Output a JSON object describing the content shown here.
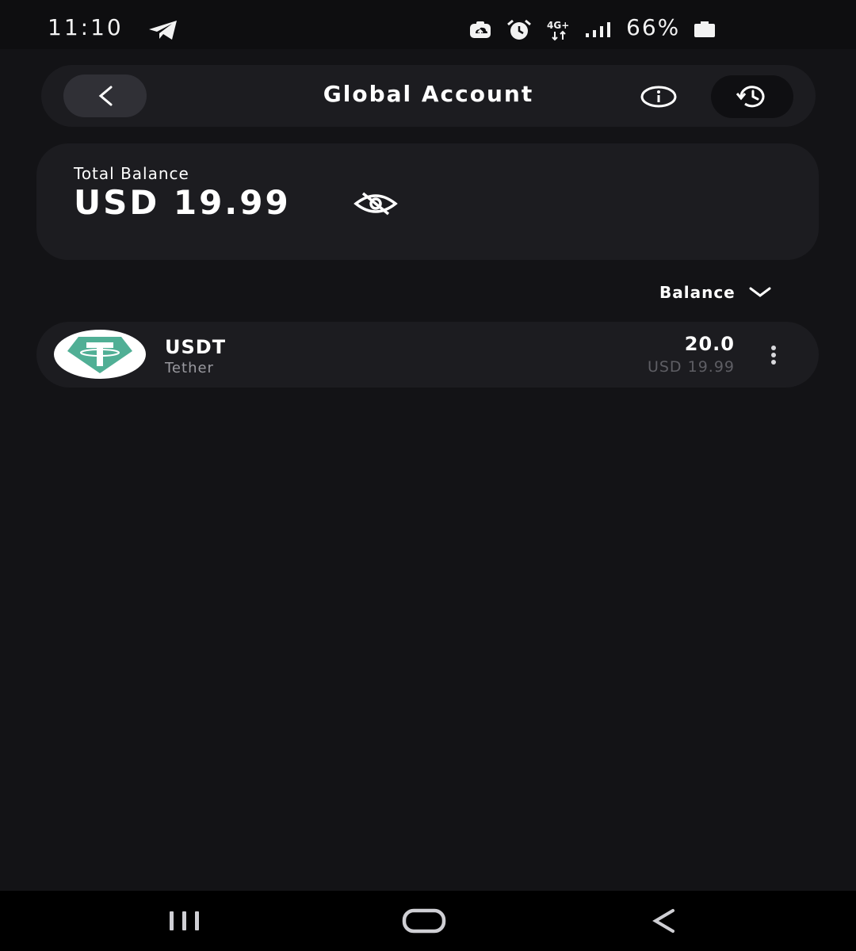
{
  "status_bar": {
    "time": "11:10",
    "network": "4G+",
    "battery_percent": "66%",
    "icons": [
      "telegram-icon",
      "cloud-upload-icon",
      "alarm-icon",
      "4g-plus-icon",
      "signal-icon",
      "battery-icon"
    ]
  },
  "header": {
    "title": "Global Account",
    "back_icon": "chevron-left-icon",
    "info_icon": "info-icon",
    "history_icon": "history-icon"
  },
  "balance": {
    "label": "Total Balance",
    "value": "USD 19.99",
    "visibility_icon": "eye-off-icon"
  },
  "sort": {
    "label": "Balance",
    "icon": "chevron-down-icon"
  },
  "assets": [
    {
      "symbol": "USDT",
      "name": "Tether",
      "amount": "20.0",
      "fiat_value": "USD 19.99",
      "logo_color": "#50AF95",
      "menu_icon": "more-vertical-icon"
    }
  ],
  "nav_bar": {
    "icons": [
      "recent-apps-icon",
      "home-icon",
      "back-icon"
    ]
  },
  "colors": {
    "background": "#131316",
    "card": "#1c1c20",
    "accent_tether": "#50AF95",
    "muted_text": "#9a9aa0"
  }
}
